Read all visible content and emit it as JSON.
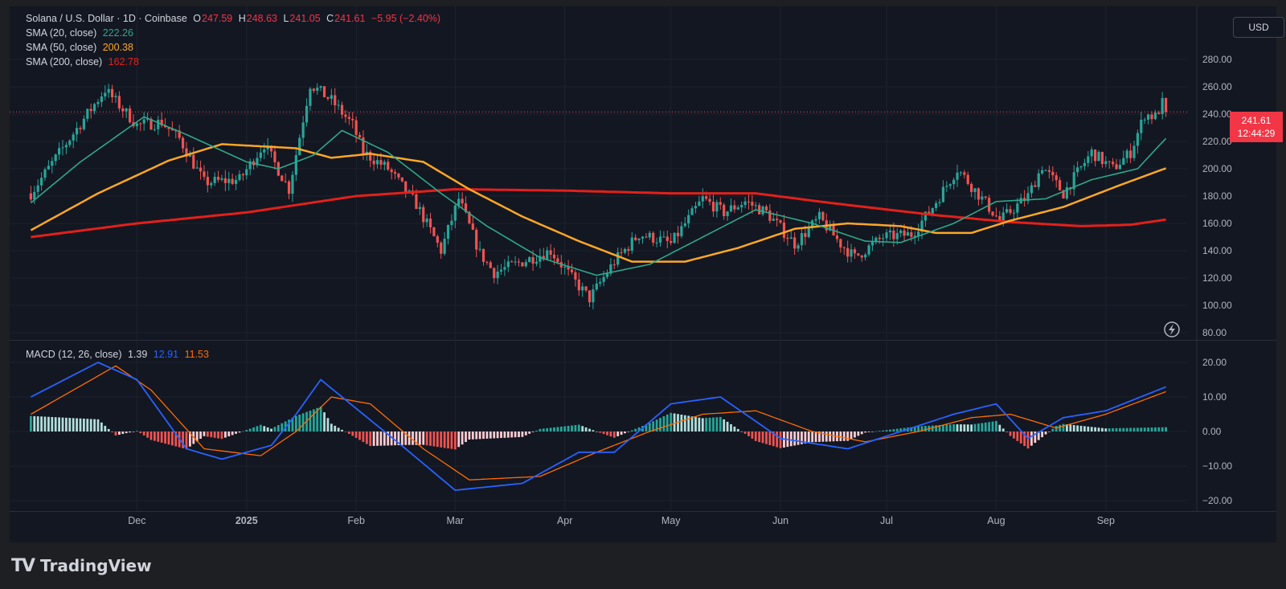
{
  "header": {
    "symbol": "Solana / U.S. Dollar · 1D · Coinbase",
    "o_label": "O",
    "o_value": "247.59",
    "h_label": "H",
    "h_value": "248.63",
    "l_label": "L",
    "l_value": "241.05",
    "c_label": "C",
    "c_value": "241.61",
    "change": "−5.95 (−2.40%)"
  },
  "indicators": {
    "sma20_label": "SMA (20, close)",
    "sma20_value": "222.26",
    "sma50_label": "SMA (50, close)",
    "sma50_value": "200.38",
    "sma200_label": "SMA (200, close)",
    "sma200_value": "162.78",
    "macd_label": "MACD (12, 26, close)",
    "macd_hist": "1.39",
    "macd_line": "12.91",
    "macd_signal": "11.53"
  },
  "currency": "USD",
  "last_price": {
    "price": "241.61",
    "countdown": "12:44:29"
  },
  "branding": {
    "logo": "TV",
    "name": "TradingView"
  },
  "colors": {
    "background": "#131722",
    "up": "#26a69a",
    "down": "#ef5350",
    "sma20": "#2ea889",
    "sma50": "#ffa726",
    "sma200": "#e3201a",
    "macd": "#2962ff",
    "signal": "#ff6d00"
  },
  "chart_data": {
    "type": "candlestick",
    "price_axis_ticks": [
      "280.00",
      "260.00",
      "240.00",
      "220.00",
      "200.00",
      "180.00",
      "160.00",
      "140.00",
      "120.00",
      "100.00",
      "80.00"
    ],
    "macd_axis_ticks": [
      "20.00",
      "10.00",
      "0.00",
      "−10.00",
      "−20.00"
    ],
    "time_labels": [
      {
        "label": "Dec",
        "date": "2024-12-01"
      },
      {
        "label": "2025",
        "date": "2025-01-01"
      },
      {
        "label": "Feb",
        "date": "2025-02-01"
      },
      {
        "label": "Mar",
        "date": "2025-03-01"
      },
      {
        "label": "Apr",
        "date": "2025-04-01"
      },
      {
        "label": "May",
        "date": "2025-05-01"
      },
      {
        "label": "Jun",
        "date": "2025-06-01"
      },
      {
        "label": "Jul",
        "date": "2025-07-01"
      },
      {
        "label": "Aug",
        "date": "2025-08-01"
      },
      {
        "label": "Sep",
        "date": "2025-09-01"
      }
    ],
    "close_keypoints": [
      [
        "2024-11-01",
        182
      ],
      [
        "2024-11-10",
        215
      ],
      [
        "2024-11-22",
        258
      ],
      [
        "2024-12-01",
        232
      ],
      [
        "2024-12-08",
        234
      ],
      [
        "2024-12-13",
        222
      ],
      [
        "2024-12-20",
        190
      ],
      [
        "2024-12-30",
        192
      ],
      [
        "2025-01-06",
        218
      ],
      [
        "2025-01-13",
        185
      ],
      [
        "2025-01-19",
        262
      ],
      [
        "2025-01-25",
        250
      ],
      [
        "2025-01-31",
        232
      ],
      [
        "2025-02-03",
        212
      ],
      [
        "2025-02-10",
        200
      ],
      [
        "2025-02-18",
        174
      ],
      [
        "2025-02-25",
        140
      ],
      [
        "2025-03-02",
        178
      ],
      [
        "2025-03-08",
        138
      ],
      [
        "2025-03-12",
        124
      ],
      [
        "2025-03-20",
        132
      ],
      [
        "2025-03-28",
        140
      ],
      [
        "2025-04-03",
        120
      ],
      [
        "2025-04-08",
        105
      ],
      [
        "2025-04-15",
        132
      ],
      [
        "2025-04-22",
        152
      ],
      [
        "2025-04-28",
        148
      ],
      [
        "2025-05-01",
        145
      ],
      [
        "2025-05-10",
        178
      ],
      [
        "2025-05-16",
        168
      ],
      [
        "2025-05-22",
        176
      ],
      [
        "2025-05-28",
        168
      ],
      [
        "2025-06-05",
        145
      ],
      [
        "2025-06-12",
        164
      ],
      [
        "2025-06-18",
        145
      ],
      [
        "2025-06-22",
        135
      ],
      [
        "2025-06-30",
        150
      ],
      [
        "2025-07-08",
        152
      ],
      [
        "2025-07-13",
        168
      ],
      [
        "2025-07-21",
        200
      ],
      [
        "2025-07-28",
        178
      ],
      [
        "2025-08-02",
        162
      ],
      [
        "2025-08-10",
        180
      ],
      [
        "2025-08-14",
        202
      ],
      [
        "2025-08-20",
        182
      ],
      [
        "2025-08-28",
        212
      ],
      [
        "2025-09-03",
        200
      ],
      [
        "2025-09-08",
        212
      ],
      [
        "2025-09-12",
        240
      ],
      [
        "2025-09-15",
        238
      ],
      [
        "2025-09-17",
        248
      ],
      [
        "2025-09-18",
        241.61
      ]
    ],
    "sma20_keypoints": [
      [
        "2024-11-01",
        175
      ],
      [
        "2024-11-15",
        205
      ],
      [
        "2024-12-03",
        238
      ],
      [
        "2024-12-15",
        225
      ],
      [
        "2025-01-01",
        205
      ],
      [
        "2025-01-10",
        200
      ],
      [
        "2025-01-20",
        210
      ],
      [
        "2025-01-28",
        228
      ],
      [
        "2025-02-10",
        212
      ],
      [
        "2025-02-25",
        182
      ],
      [
        "2025-03-10",
        158
      ],
      [
        "2025-03-25",
        135
      ],
      [
        "2025-04-10",
        122
      ],
      [
        "2025-04-25",
        130
      ],
      [
        "2025-05-10",
        150
      ],
      [
        "2025-05-25",
        170
      ],
      [
        "2025-06-10",
        160
      ],
      [
        "2025-06-25",
        147
      ],
      [
        "2025-07-05",
        146
      ],
      [
        "2025-07-20",
        160
      ],
      [
        "2025-08-01",
        176
      ],
      [
        "2025-08-15",
        178
      ],
      [
        "2025-08-28",
        192
      ],
      [
        "2025-09-10",
        200
      ],
      [
        "2025-09-18",
        222.26
      ]
    ],
    "sma50_keypoints": [
      [
        "2024-11-01",
        155
      ],
      [
        "2024-11-20",
        182
      ],
      [
        "2024-12-10",
        206
      ],
      [
        "2024-12-25",
        218
      ],
      [
        "2025-01-15",
        215
      ],
      [
        "2025-01-25",
        208
      ],
      [
        "2025-02-05",
        211
      ],
      [
        "2025-02-20",
        205
      ],
      [
        "2025-03-05",
        185
      ],
      [
        "2025-03-20",
        165
      ],
      [
        "2025-04-05",
        147
      ],
      [
        "2025-04-20",
        132
      ],
      [
        "2025-05-05",
        132
      ],
      [
        "2025-05-20",
        142
      ],
      [
        "2025-06-05",
        156
      ],
      [
        "2025-06-20",
        160
      ],
      [
        "2025-07-05",
        158
      ],
      [
        "2025-07-15",
        153
      ],
      [
        "2025-07-25",
        153
      ],
      [
        "2025-08-05",
        162
      ],
      [
        "2025-08-20",
        172
      ],
      [
        "2025-09-05",
        188
      ],
      [
        "2025-09-18",
        200.38
      ]
    ],
    "sma200_keypoints": [
      [
        "2024-11-01",
        150
      ],
      [
        "2024-12-01",
        160
      ],
      [
        "2025-01-01",
        168
      ],
      [
        "2025-02-01",
        180
      ],
      [
        "2025-03-01",
        185
      ],
      [
        "2025-04-01",
        184
      ],
      [
        "2025-05-01",
        182
      ],
      [
        "2025-05-25",
        182
      ],
      [
        "2025-06-15",
        175
      ],
      [
        "2025-07-15",
        166
      ],
      [
        "2025-08-05",
        161
      ],
      [
        "2025-08-25",
        158
      ],
      [
        "2025-09-08",
        159
      ],
      [
        "2025-09-18",
        162.78
      ]
    ],
    "macd_keypoints": [
      [
        "2024-11-01",
        10
      ],
      [
        "2024-11-20",
        20
      ],
      [
        "2024-12-01",
        15
      ],
      [
        "2024-12-15",
        -5
      ],
      [
        "2024-12-25",
        -8
      ],
      [
        "2025-01-08",
        -4
      ],
      [
        "2025-01-15",
        5
      ],
      [
        "2025-01-22",
        15
      ],
      [
        "2025-02-03",
        5
      ],
      [
        "2025-02-15",
        -5
      ],
      [
        "2025-03-01",
        -17
      ],
      [
        "2025-03-20",
        -15
      ],
      [
        "2025-04-05",
        -6
      ],
      [
        "2025-04-15",
        -6
      ],
      [
        "2025-05-01",
        8
      ],
      [
        "2025-05-15",
        10
      ],
      [
        "2025-06-01",
        -2
      ],
      [
        "2025-06-20",
        -5
      ],
      [
        "2025-07-05",
        0
      ],
      [
        "2025-07-20",
        5
      ],
      [
        "2025-08-01",
        8
      ],
      [
        "2025-08-10",
        -2
      ],
      [
        "2025-08-20",
        4
      ],
      [
        "2025-09-01",
        6
      ],
      [
        "2025-09-18",
        12.91
      ]
    ],
    "signal_keypoints": [
      [
        "2024-11-01",
        5
      ],
      [
        "2024-11-25",
        19
      ],
      [
        "2024-12-05",
        12
      ],
      [
        "2024-12-20",
        -5
      ],
      [
        "2025-01-05",
        -7
      ],
      [
        "2025-01-15",
        0
      ],
      [
        "2025-01-25",
        10
      ],
      [
        "2025-02-05",
        8
      ],
      [
        "2025-02-20",
        -5
      ],
      [
        "2025-03-05",
        -14
      ],
      [
        "2025-03-25",
        -13
      ],
      [
        "2025-04-10",
        -6
      ],
      [
        "2025-04-25",
        0
      ],
      [
        "2025-05-10",
        5
      ],
      [
        "2025-05-25",
        6
      ],
      [
        "2025-06-10",
        0
      ],
      [
        "2025-06-25",
        -3
      ],
      [
        "2025-07-10",
        0
      ],
      [
        "2025-07-25",
        4
      ],
      [
        "2025-08-05",
        5
      ],
      [
        "2025-08-18",
        1
      ],
      [
        "2025-09-01",
        5
      ],
      [
        "2025-09-18",
        11.53
      ]
    ]
  }
}
